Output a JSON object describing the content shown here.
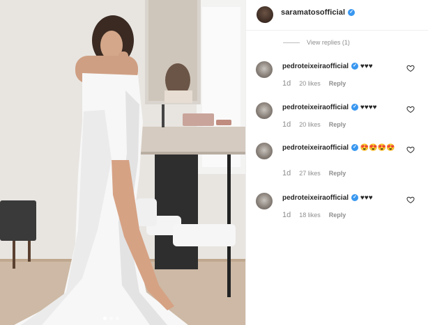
{
  "header": {
    "username": "saramatosofficial",
    "verified": true
  },
  "view_replies": "View replies (1)",
  "comments": [
    {
      "username": "pedroteixeiraofficial",
      "text": "♥♥♥",
      "time": "1d",
      "likes": "20 likes",
      "reply": "Reply"
    },
    {
      "username": "pedroteixeiraofficial",
      "text": "♥♥♥♥",
      "time": "1d",
      "likes": "20 likes",
      "reply": "Reply"
    },
    {
      "username": "pedroteixeiraofficial",
      "text": "😍😍😍😍",
      "time": "1d",
      "likes": "27 likes",
      "reply": "Reply"
    },
    {
      "username": "pedroteixeiraofficial",
      "text": "♥♥♥",
      "time": "1d",
      "likes": "18 likes",
      "reply": "Reply"
    }
  ],
  "carousel": {
    "count": 3,
    "active": 1
  },
  "colors": {
    "verified": "#3897f0",
    "muted": "#8e8e8e",
    "text": "#262626"
  }
}
